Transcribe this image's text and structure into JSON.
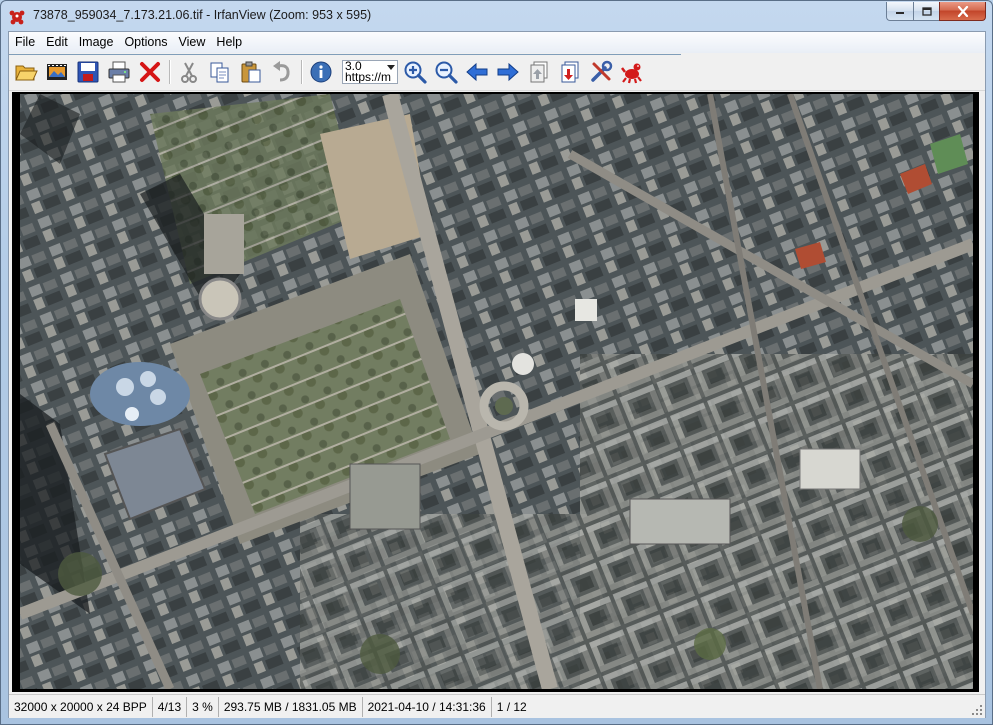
{
  "window": {
    "title": "73878_959034_7.173.21.06.tif - IrfanView (Zoom: 953 x 595)"
  },
  "menu": {
    "items": [
      "File",
      "Edit",
      "Image",
      "Options",
      "View",
      "Help"
    ]
  },
  "toolbar": {
    "zoom_value": "3.0",
    "url_text": "https://m",
    "icons": [
      "open-folder",
      "slideshow",
      "save",
      "print",
      "delete",
      "cut",
      "copy",
      "paste",
      "undo",
      "info",
      "zoom-in",
      "zoom-out",
      "previous",
      "next",
      "first-page",
      "last-page",
      "settings",
      "irfanview-logo"
    ]
  },
  "statusbar": {
    "dimensions": "32000 x 20000 x 24 BPP",
    "page": "4/13",
    "zoom_percent": "3 %",
    "memory": "293.75 MB / 1831.05 MB",
    "datetime": "2021-04-10 / 14:31:36",
    "file_index": "1 / 12"
  },
  "colors": {
    "accent": "#3b6fb6",
    "close": "#c2452a"
  }
}
